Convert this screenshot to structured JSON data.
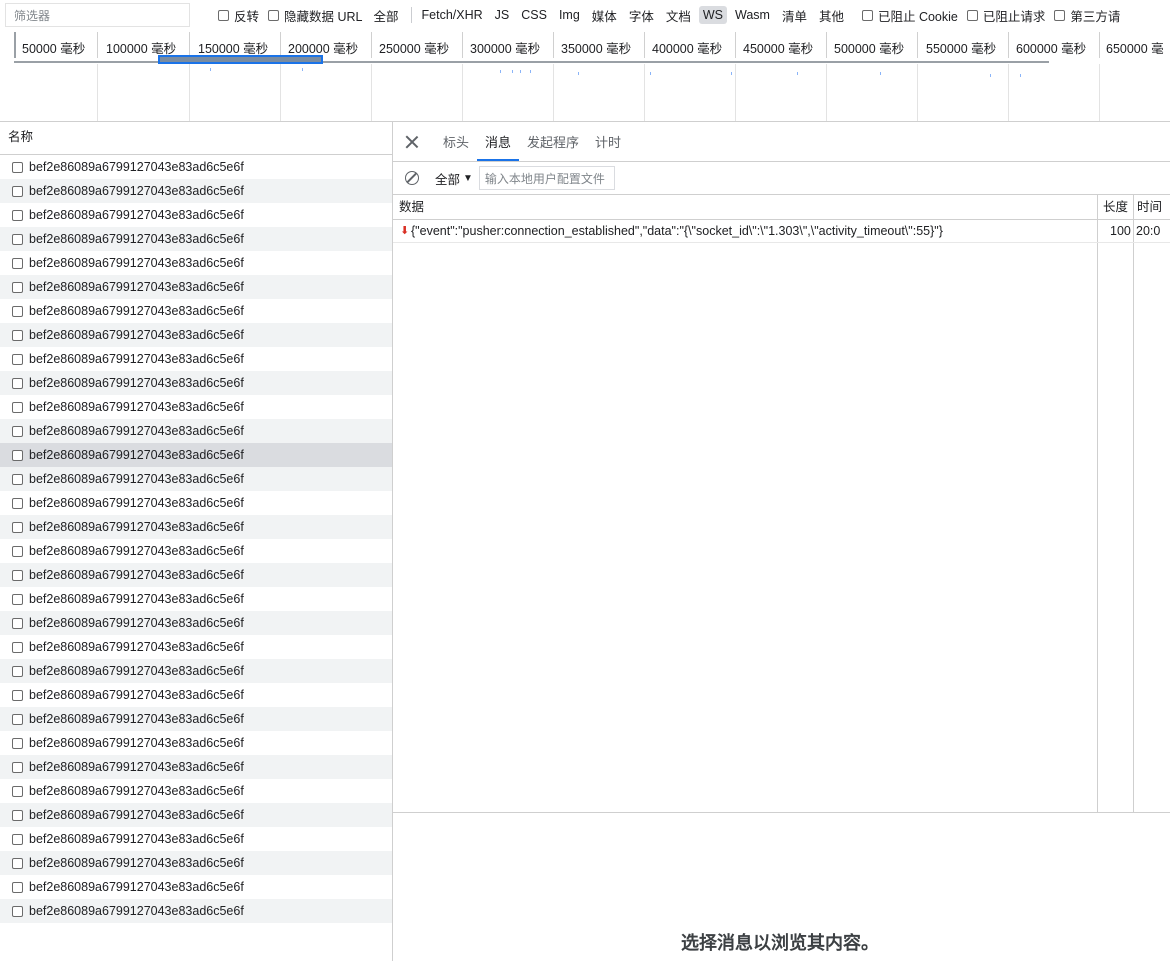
{
  "filter": {
    "placeholder": "筛选器",
    "invert_label": "反转",
    "hide_data_url_label": "隐藏数据 URL",
    "types": [
      "全部",
      "Fetch/XHR",
      "JS",
      "CSS",
      "Img",
      "媒体",
      "字体",
      "文档",
      "WS",
      "Wasm",
      "清单",
      "其他"
    ],
    "active_type": "WS",
    "blocked_cookies_label": "已阻止 Cookie",
    "blocked_requests_label": "已阻止请求",
    "third_party_label": "第三方请"
  },
  "timeline": {
    "ticks": [
      "50000 毫秒",
      "100000 毫秒",
      "150000 毫秒",
      "200000 毫秒",
      "250000 毫秒",
      "300000 毫秒",
      "350000 毫秒",
      "400000 毫秒",
      "450000 毫秒",
      "500000 毫秒",
      "550000 毫秒",
      "600000 毫秒",
      "650000 毫"
    ]
  },
  "requests": {
    "header": "名称",
    "items": [
      "bef2e86089a6799127043e83ad6c5e6f",
      "bef2e86089a6799127043e83ad6c5e6f",
      "bef2e86089a6799127043e83ad6c5e6f",
      "bef2e86089a6799127043e83ad6c5e6f",
      "bef2e86089a6799127043e83ad6c5e6f",
      "bef2e86089a6799127043e83ad6c5e6f",
      "bef2e86089a6799127043e83ad6c5e6f",
      "bef2e86089a6799127043e83ad6c5e6f",
      "bef2e86089a6799127043e83ad6c5e6f",
      "bef2e86089a6799127043e83ad6c5e6f",
      "bef2e86089a6799127043e83ad6c5e6f",
      "bef2e86089a6799127043e83ad6c5e6f",
      "bef2e86089a6799127043e83ad6c5e6f",
      "bef2e86089a6799127043e83ad6c5e6f",
      "bef2e86089a6799127043e83ad6c5e6f",
      "bef2e86089a6799127043e83ad6c5e6f",
      "bef2e86089a6799127043e83ad6c5e6f",
      "bef2e86089a6799127043e83ad6c5e6f",
      "bef2e86089a6799127043e83ad6c5e6f",
      "bef2e86089a6799127043e83ad6c5e6f",
      "bef2e86089a6799127043e83ad6c5e6f",
      "bef2e86089a6799127043e83ad6c5e6f",
      "bef2e86089a6799127043e83ad6c5e6f",
      "bef2e86089a6799127043e83ad6c5e6f",
      "bef2e86089a6799127043e83ad6c5e6f",
      "bef2e86089a6799127043e83ad6c5e6f",
      "bef2e86089a6799127043e83ad6c5e6f",
      "bef2e86089a6799127043e83ad6c5e6f",
      "bef2e86089a6799127043e83ad6c5e6f",
      "bef2e86089a6799127043e83ad6c5e6f",
      "bef2e86089a6799127043e83ad6c5e6f",
      "bef2e86089a6799127043e83ad6c5e6f"
    ],
    "selected_index": 12
  },
  "detail": {
    "tabs": [
      "标头",
      "消息",
      "发起程序",
      "计时"
    ],
    "active_tab": "消息",
    "message_filter": "全部",
    "message_search_placeholder": "输入本地用户配置文件",
    "columns": {
      "data": "数据",
      "length": "长度",
      "time": "时间"
    },
    "messages": [
      {
        "direction": "received",
        "data": "{\"event\":\"pusher:connection_established\",\"data\":\"{\\\"socket_id\\\":\\\"1.303\\\",\\\"activity_timeout\\\":55}\"}",
        "length": "100",
        "time": "20:0"
      }
    ],
    "empty_text": "选择消息以浏览其内容。"
  },
  "colors": {
    "accent": "#1a73e8",
    "received_arrow": "#d93025"
  }
}
